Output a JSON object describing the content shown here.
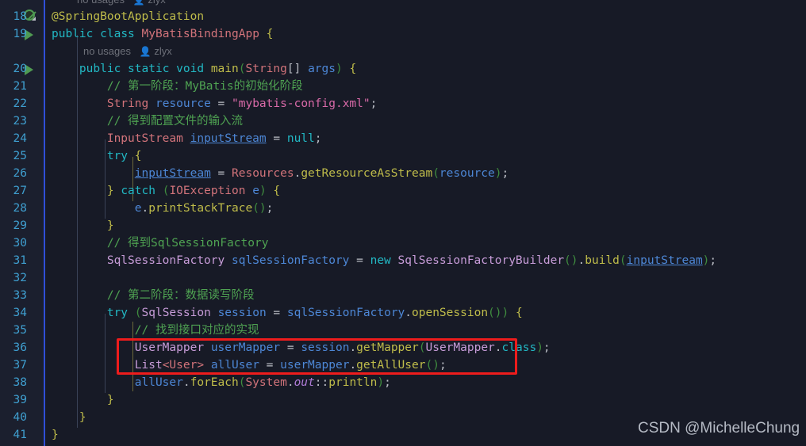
{
  "editor": {
    "theme_background": "#171a26",
    "gutter_background": "#1b1f2e",
    "line_number_color": "#3f9fd0",
    "change_marker_color": "#2f4fd8",
    "highlight_box_color": "#ee1c1c"
  },
  "inlay_hints": {
    "clipped_top": {
      "usages": "no usages",
      "author": "zlyx"
    },
    "class_level": {
      "usages": "no usages",
      "author": "zlyx"
    },
    "person_icon": "person-icon"
  },
  "gutter": {
    "icons": [
      {
        "line": 18,
        "icon": "spring-bean-icon"
      },
      {
        "line": 19,
        "icon": "run-arrow-icon"
      },
      {
        "line": 20,
        "icon": "run-arrow-icon"
      }
    ]
  },
  "line_numbers": [
    18,
    19,
    20,
    21,
    22,
    23,
    24,
    25,
    26,
    27,
    28,
    29,
    30,
    31,
    32,
    33,
    34,
    35,
    36,
    37,
    38,
    39,
    40,
    41
  ],
  "code_lines": [
    {
      "num": 18,
      "text": "@SpringBootApplication"
    },
    {
      "num": 19,
      "text": "public class MyBatisBindingApp {"
    },
    {
      "num": 20,
      "text": "    public static void main(String[] args) {"
    },
    {
      "num": 21,
      "text": "        // 第一阶段：MyBatis的初始化阶段"
    },
    {
      "num": 22,
      "text": "        String resource = \"mybatis-config.xml\";"
    },
    {
      "num": 23,
      "text": "        // 得到配置文件的输入流"
    },
    {
      "num": 24,
      "text": "        InputStream inputStream = null;"
    },
    {
      "num": 25,
      "text": "        try {"
    },
    {
      "num": 26,
      "text": "            inputStream = Resources.getResourceAsStream(resource);"
    },
    {
      "num": 27,
      "text": "        } catch (IOException e) {"
    },
    {
      "num": 28,
      "text": "            e.printStackTrace();"
    },
    {
      "num": 29,
      "text": "        }"
    },
    {
      "num": 30,
      "text": "        // 得到SqlSessionFactory"
    },
    {
      "num": 31,
      "text": "        SqlSessionFactory sqlSessionFactory = new SqlSessionFactoryBuilder().build(inputStream);"
    },
    {
      "num": 32,
      "text": ""
    },
    {
      "num": 33,
      "text": "        // 第二阶段：数据读写阶段"
    },
    {
      "num": 34,
      "text": "        try (SqlSession session = sqlSessionFactory.openSession()) {"
    },
    {
      "num": 35,
      "text": "            // 找到接口对应的实现"
    },
    {
      "num": 36,
      "text": "            UserMapper userMapper = session.getMapper(UserMapper.class);"
    },
    {
      "num": 37,
      "text": "            List<User> allUser = userMapper.getAllUser();"
    },
    {
      "num": 38,
      "text": "            allUser.forEach(System.out::println);"
    },
    {
      "num": 39,
      "text": "        }"
    },
    {
      "num": 40,
      "text": "    }"
    },
    {
      "num": 41,
      "text": "}"
    }
  ],
  "annotation": {
    "red_box_lines": [
      36,
      37
    ],
    "red_box_note": "highlighted mapper acquisition and query lines"
  },
  "watermark": {
    "text": "CSDN @MichelleChung"
  }
}
